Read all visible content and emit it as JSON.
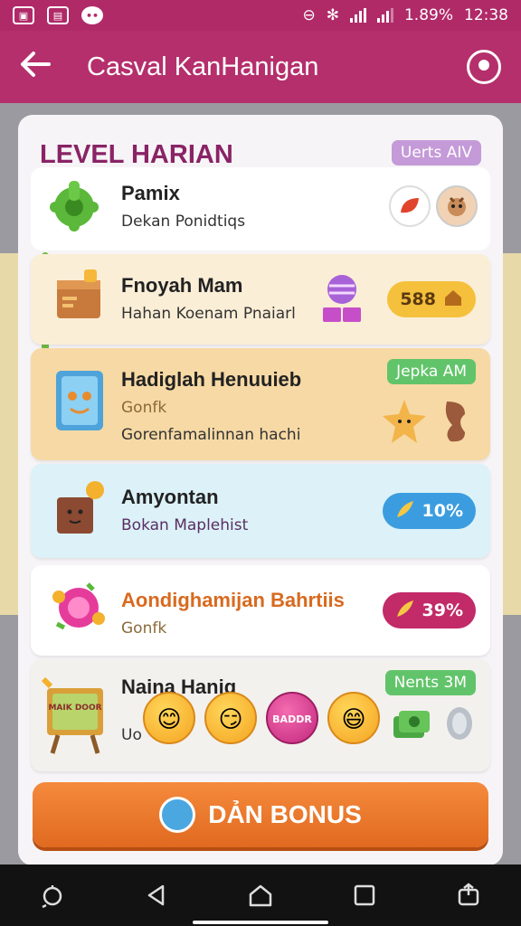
{
  "status": {
    "battery": "1.89%",
    "time": "12:38"
  },
  "appbar": {
    "title": "Casval KanHanigan"
  },
  "sheet": {
    "title": "LEVEL HARIAN",
    "top_tag": "Uerts AIV"
  },
  "rows": [
    {
      "title": "Pamix",
      "subtitle": "Dekan Ponidtiqs"
    },
    {
      "title": "Fnoyah Mam",
      "subtitle": "Hahan Koenam Pnaiarl",
      "pill": "588"
    },
    {
      "title": "Hadiglah Henuuieb",
      "subtitle": "Gonfk",
      "subtitle2": "Gorenfamalinnan hachi",
      "tag": "Jepka AM"
    },
    {
      "title": "Amyontan",
      "subtitle": "Bokan Maplehist",
      "pill": "10%"
    },
    {
      "title": "Aondighamijan Bahrtiis",
      "subtitle": "Gonfk",
      "pill": "39%"
    },
    {
      "title": "Naina Hanig",
      "subtitle": "Uo",
      "tag": "Nents 3M",
      "sign_text": "MAIK DOOR"
    }
  ],
  "emojis": [
    "😊",
    "😏",
    "😊",
    "😄"
  ],
  "pink_emoji_label": "BADDR",
  "cta": {
    "label": "DẢN BONUS"
  },
  "colors": {
    "accent": "#b52f6c",
    "orange": "#e8782b",
    "green_tag": "#62c46a"
  }
}
